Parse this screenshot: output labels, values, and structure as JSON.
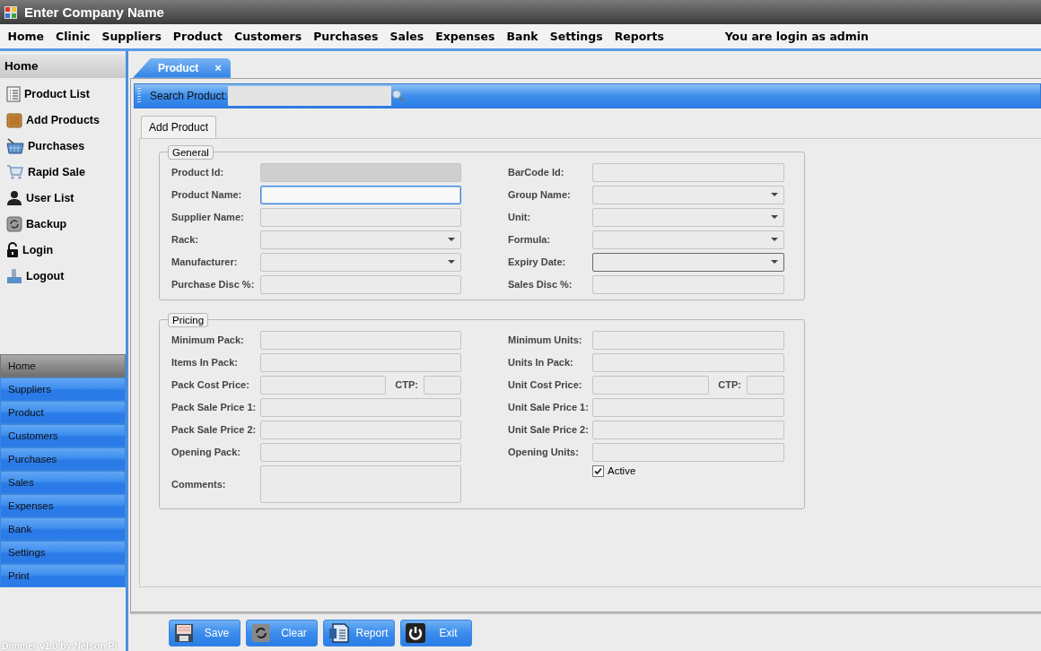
{
  "window": {
    "title": "Enter Company Name"
  },
  "menu": [
    "Home",
    "Clinic",
    "Suppliers",
    "Product",
    "Customers",
    "Purchases",
    "Sales",
    "Expenses",
    "Bank",
    "Settings",
    "Reports"
  ],
  "login_status": "You are login as admin",
  "sidebar": {
    "header": "Home",
    "items": [
      "Product List",
      "Add Products",
      "Purchases",
      "Rapid Sale",
      "User List",
      "Backup",
      "Login",
      "Logout"
    ]
  },
  "nav": [
    {
      "label": "Home",
      "selected": true
    },
    {
      "label": "Suppliers",
      "selected": false
    },
    {
      "label": "Product",
      "selected": false
    },
    {
      "label": "Customers",
      "selected": false
    },
    {
      "label": "Purchases",
      "selected": false
    },
    {
      "label": "Sales",
      "selected": false
    },
    {
      "label": "Expenses",
      "selected": false
    },
    {
      "label": "Bank",
      "selected": false
    },
    {
      "label": "Settings",
      "selected": false
    },
    {
      "label": "Print",
      "selected": false
    }
  ],
  "footer": "Dimmer v1.0 by Nelson Pi",
  "document_tab": {
    "label": "Product",
    "close": "×"
  },
  "search": {
    "label": "Search Product:"
  },
  "form_tab": {
    "label": "Add Product"
  },
  "groups": [
    {
      "title": "General",
      "rows": [
        {
          "left": {
            "label": "Product Id:",
            "kind": "readonly",
            "focused": false,
            "hovered": false
          },
          "right": {
            "label": "BarCode Id:",
            "kind": "text",
            "focused": false,
            "hovered": false
          }
        },
        {
          "left": {
            "label": "Product Name:",
            "kind": "text",
            "focused": true,
            "hovered": false
          },
          "right": {
            "label": "Group Name:",
            "kind": "combo",
            "focused": false,
            "hovered": false
          }
        },
        {
          "left": {
            "label": "Supplier Name:",
            "kind": "text",
            "focused": false,
            "hovered": false
          },
          "right": {
            "label": "Unit:",
            "kind": "combo",
            "focused": false,
            "hovered": false
          }
        },
        {
          "left": {
            "label": "Rack:",
            "kind": "combo",
            "focused": false,
            "hovered": false
          },
          "right": {
            "label": "Formula:",
            "kind": "combo",
            "focused": false,
            "hovered": false
          }
        },
        {
          "left": {
            "label": "Manufacturer:",
            "kind": "combo",
            "focused": false,
            "hovered": false
          },
          "right": {
            "label": "Expiry Date:",
            "kind": "combo",
            "focused": false,
            "hovered": true
          }
        },
        {
          "left": {
            "label": "Purchase Disc %:",
            "kind": "text",
            "focused": false,
            "hovered": false
          },
          "right": {
            "label": "Sales Disc %:",
            "kind": "text",
            "focused": false,
            "hovered": false
          }
        }
      ]
    },
    {
      "title": "Pricing",
      "rows": [
        {
          "left": {
            "label": "Minimum Pack:",
            "kind": "text",
            "focused": false,
            "hovered": false
          },
          "right": {
            "label": "Minimum Units:",
            "kind": "text",
            "focused": false,
            "hovered": false
          }
        },
        {
          "left": {
            "label": "Items In Pack:",
            "kind": "text",
            "focused": false,
            "hovered": false
          },
          "right": {
            "label": "Units In Pack:",
            "kind": "text",
            "focused": false,
            "hovered": false
          }
        },
        {
          "left": {
            "label": "Pack Cost Price:",
            "kind": "split",
            "focused": false,
            "hovered": false,
            "extra_label": "CTP:"
          },
          "right": {
            "label": "Unit Cost Price:",
            "kind": "split",
            "focused": false,
            "hovered": false,
            "extra_label": "CTP:"
          }
        },
        {
          "left": {
            "label": "Pack Sale Price 1:",
            "kind": "text",
            "focused": false,
            "hovered": false
          },
          "right": {
            "label": "Unit Sale Price 1:",
            "kind": "text",
            "focused": false,
            "hovered": false
          }
        },
        {
          "left": {
            "label": "Pack Sale Price 2:",
            "kind": "text",
            "focused": false,
            "hovered": false
          },
          "right": {
            "label": "Unit Sale Price 2:",
            "kind": "text",
            "focused": false,
            "hovered": false
          }
        },
        {
          "left": {
            "label": "Opening Pack:",
            "kind": "text",
            "focused": false,
            "hovered": false
          },
          "right": {
            "label": "Opening Units:",
            "kind": "text",
            "focused": false,
            "hovered": false
          }
        },
        {
          "left": {
            "label": "Comments:",
            "kind": "memo",
            "focused": false,
            "hovered": false
          },
          "right": {
            "label": "Active",
            "kind": "checkbox",
            "checked": true
          }
        }
      ]
    }
  ],
  "buttons": [
    "Save",
    "Clear",
    "Report",
    "Exit"
  ]
}
